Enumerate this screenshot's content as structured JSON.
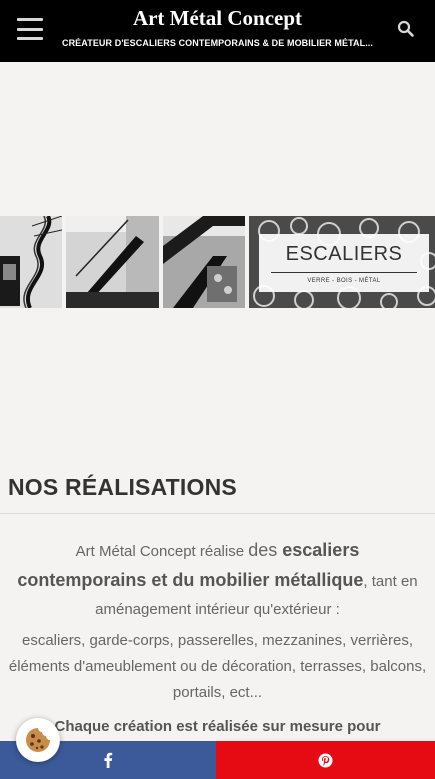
{
  "header": {
    "title": "Art Métal Concept",
    "tagline": "CRÉATEUR D'ESCALIERS CONTEMPORAINS & DE MOBILIER MÉTAL...",
    "menu_icon": "hamburger-menu-icon",
    "search_icon": "search-icon"
  },
  "banner": {
    "label": "ESCALIERS",
    "sublabel": "VERRE - BOIS - MÉTAL"
  },
  "section": {
    "title": "NOS RÉALISATIONS"
  },
  "content": {
    "intro_part1": "Art Métal Concept réalise ",
    "intro_part2": "des ",
    "intro_bold": "escaliers contemporains et du mobilier métallique",
    "intro_part3": ", tant en aménagement intérieur qu'extérieur :",
    "list": "escaliers, garde-corps, passerelles, mezzanines, verrières, éléments d'ameublement ou de décoration, terrasses, balcons, portails, ect...",
    "emphasis": "Chaque création est réalisée sur mesure pour"
  },
  "share": {
    "facebook_icon": "facebook-icon",
    "pinterest_icon": "pinterest-icon",
    "facebook_color": "#3c5a99",
    "pinterest_color": "#e60a13"
  },
  "cookie_icon": "cookie-icon"
}
